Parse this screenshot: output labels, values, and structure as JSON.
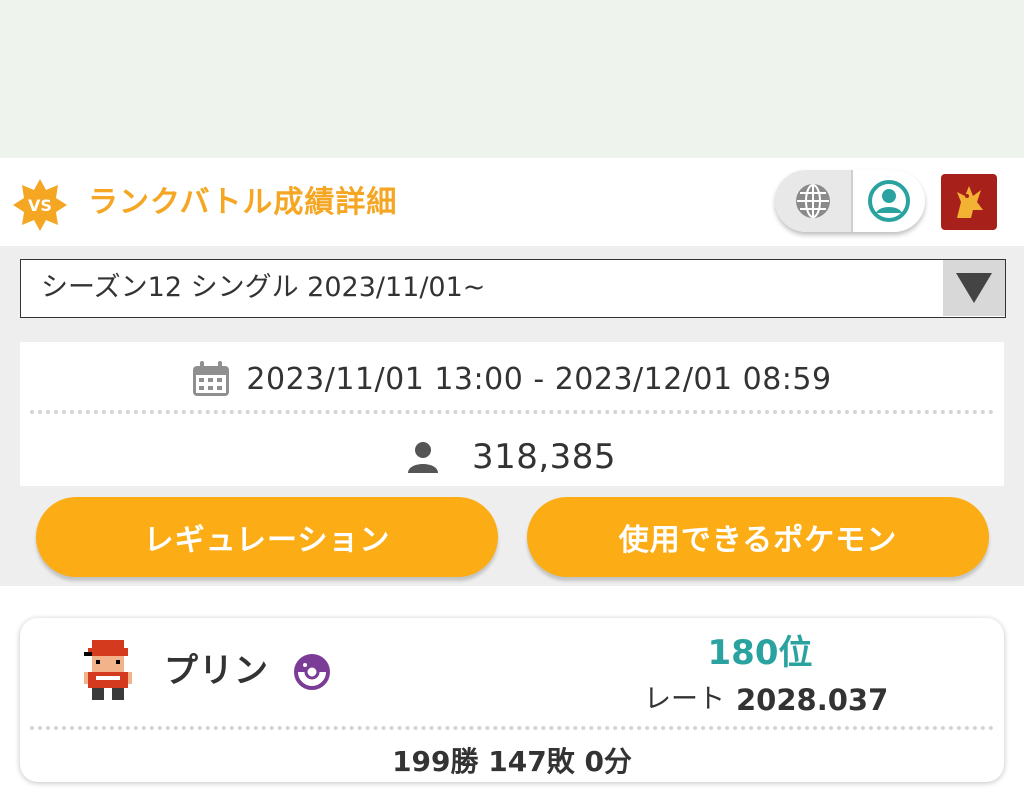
{
  "header": {
    "badge_text": "VS",
    "title": "ランクバトル成績詳細",
    "globe_icon": "globe-icon",
    "user_icon": "user-circle-icon",
    "avatar_icon": "trainer-avatar"
  },
  "season_select": {
    "selected": "シーズン12 シングル 2023/11/01~",
    "arrow_icon": "triangle-down-icon"
  },
  "season_info": {
    "period": "2023/11/01 13:00 - 2023/12/01 08:59",
    "players": "318,385",
    "calendar_icon": "calendar-icon",
    "person_icon": "person-icon"
  },
  "buttons": {
    "regulation": "レギュレーション",
    "usable_pokemon": "使用できるポケモン"
  },
  "player": {
    "name": "プリン",
    "rank": "180位",
    "rate_label": "レート",
    "rate_value": "2028.037",
    "record": "199勝 147敗 0分",
    "ball_icon": "poke-ball-icon",
    "sprite_icon": "trainer-sprite"
  },
  "colors": {
    "accent": "#fcac14",
    "title": "#f5a623",
    "rank": "#2aa3a0",
    "ball": "#7a3c96",
    "user_icon": "#2aa3a0",
    "avatar_bg": "#a8201a"
  }
}
